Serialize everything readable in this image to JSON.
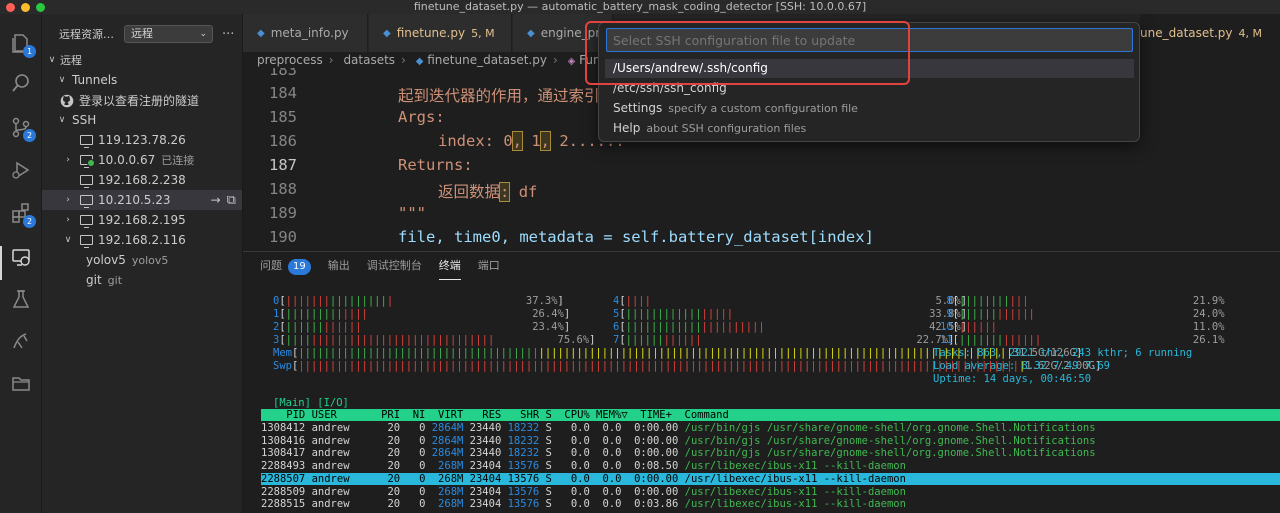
{
  "window": {
    "title": "finetune_dataset.py — automatic_battery_mask_coding_detector [SSH: 10.0.0.67]"
  },
  "activity_bar": {
    "badges": {
      "explorer": "1",
      "source_control": "2",
      "extensions": "2"
    }
  },
  "sidebar": {
    "header": "远程资源…",
    "select_value": "远程",
    "section": "远程",
    "tunnels_label": "Tunnels",
    "tunnels_signin": "登录以查看注册的隧道",
    "ssh_label": "SSH",
    "hosts": [
      {
        "label": "119.123.78.26",
        "sub": ""
      },
      {
        "label": "10.0.0.67",
        "sub": "已连接"
      },
      {
        "label": "192.168.2.238",
        "sub": ""
      },
      {
        "label": "10.210.5.23",
        "sub": ""
      },
      {
        "label": "192.168.2.195",
        "sub": ""
      },
      {
        "label": "192.168.2.116",
        "sub": ""
      }
    ],
    "folders": [
      {
        "label": "yolov5",
        "sub": "yolov5"
      },
      {
        "label": "git",
        "sub": "git"
      }
    ]
  },
  "tabs": [
    {
      "label": "meta_info.py",
      "status": ""
    },
    {
      "label": "finetune.py",
      "status": "5, M"
    },
    {
      "label": "engine_pro",
      "status": ""
    },
    {
      "label": "une_dataset.py",
      "status": "4, M"
    }
  ],
  "breadcrumbs": [
    "preprocess",
    "datasets",
    "finetune_dataset.py",
    "Funetun"
  ],
  "editor": {
    "line_numbers": [
      "183",
      "184",
      "185",
      "186",
      "187",
      "188",
      "189",
      "190"
    ],
    "lines": {
      "l184": "起到迭代器的作用，通过索引",
      "l185": "Args:",
      "l186_a": "index: 0",
      "l186_b": ",",
      "l186_c": " 1",
      "l186_d": ",",
      "l186_e": " 2......",
      "l187": "Returns:",
      "l188_a": "返回数据",
      "l188_b": ":",
      "l188_c": " df",
      "l189": "\"\"\"",
      "l190": "file, time0, metadata = self.battery_dataset[index]"
    }
  },
  "panel": {
    "tabs": [
      "问题",
      "输出",
      "调试控制台",
      "终端",
      "端口"
    ],
    "problems_count": "19"
  },
  "terminal": {
    "cpu": [
      {
        "id": "0",
        "pct": "37.3%"
      },
      {
        "id": "1",
        "pct": "26.4%"
      },
      {
        "id": "2",
        "pct": "23.4%"
      },
      {
        "id": "3",
        "pct": "75.6%"
      },
      {
        "id": "4",
        "pct": "5.0%"
      },
      {
        "id": "5",
        "pct": "33.8%"
      },
      {
        "id": "6",
        "pct": "42.5%"
      },
      {
        "id": "7",
        "pct": "22.7%"
      },
      {
        "id": "8",
        "pct": "21.9%"
      },
      {
        "id": "9",
        "pct": "24.0%"
      },
      {
        "id": "10",
        "pct": "11.0%"
      },
      {
        "id": "11",
        "pct": "26.1%"
      }
    ],
    "mem_label": "Mem",
    "mem_value": "31.5G/126G",
    "swp_label": "Swp",
    "swp_value": "1.62G/2.00G",
    "tasks": "Tasks: 863, 2921 thr, 243 kthr; 6 running",
    "load": "Load average: 8.32 7.49 7.69",
    "uptime": "Uptime: 14 days, 00:46:50",
    "tabs": "[Main] [I/O]",
    "header": "    PID USER       PRI  NI  VIRT   RES   SHR S  CPU% MEM%▽  TIME+  Command",
    "rows": [
      {
        "pid": "1308412",
        "user": "andrew",
        "pri": "20",
        "ni": "0",
        "virt": "2864M",
        "res": "23440",
        "shr": "18232",
        "s": "S",
        "cpu": "0.0",
        "mem": "0.0",
        "time": "0:00.00",
        "cmd": "/usr/bin/gjs /usr/share/gnome-shell/org.gnome.Shell.Notifications"
      },
      {
        "pid": "1308416",
        "user": "andrew",
        "pri": "20",
        "ni": "0",
        "virt": "2864M",
        "res": "23440",
        "shr": "18232",
        "s": "S",
        "cpu": "0.0",
        "mem": "0.0",
        "time": "0:00.00",
        "cmd": "/usr/bin/gjs /usr/share/gnome-shell/org.gnome.Shell.Notifications"
      },
      {
        "pid": "1308417",
        "user": "andrew",
        "pri": "20",
        "ni": "0",
        "virt": "2864M",
        "res": "23440",
        "shr": "18232",
        "s": "S",
        "cpu": "0.0",
        "mem": "0.0",
        "time": "0:00.00",
        "cmd": "/usr/bin/gjs /usr/share/gnome-shell/org.gnome.Shell.Notifications"
      },
      {
        "pid": "2288493",
        "user": "andrew",
        "pri": "20",
        "ni": "0",
        "virt": "268M",
        "res": "23404",
        "shr": "13576",
        "s": "S",
        "cpu": "0.0",
        "mem": "0.0",
        "time": "0:08.50",
        "cmd": "/usr/libexec/ibus-x11 --kill-daemon"
      },
      {
        "pid": "2288507",
        "user": "andrew",
        "pri": "20",
        "ni": "0",
        "virt": "268M",
        "res": "23404",
        "shr": "13576",
        "s": "S",
        "cpu": "0.0",
        "mem": "0.0",
        "time": "0:00.00",
        "cmd": "/usr/libexec/ibus-x11 --kill-daemon"
      },
      {
        "pid": "2288509",
        "user": "andrew",
        "pri": "20",
        "ni": "0",
        "virt": "268M",
        "res": "23404",
        "shr": "13576",
        "s": "S",
        "cpu": "0.0",
        "mem": "0.0",
        "time": "0:00.00",
        "cmd": "/usr/libexec/ibus-x11 --kill-daemon"
      },
      {
        "pid": "2288515",
        "user": "andrew",
        "pri": "20",
        "ni": "0",
        "virt": "268M",
        "res": "23404",
        "shr": "13576",
        "s": "S",
        "cpu": "0.0",
        "mem": "0.0",
        "time": "0:03.86",
        "cmd": "/usr/libexec/ibus-x11 --kill-daemon"
      }
    ]
  },
  "quick_pick": {
    "placeholder": "Select SSH configuration file to update",
    "items": [
      {
        "label": "/Users/andrew/.ssh/config",
        "desc": ""
      },
      {
        "label": "/etc/ssh/ssh_config",
        "desc": ""
      },
      {
        "label": "Settings",
        "desc": "specify a custom configuration file"
      },
      {
        "label": "Help",
        "desc": "about SSH configuration files"
      }
    ]
  },
  "colors": {
    "accent": "#2a79d9",
    "highlight_box": "#e0443e",
    "htop_header": "#23d18b",
    "htop_selected": "#29b8db"
  }
}
